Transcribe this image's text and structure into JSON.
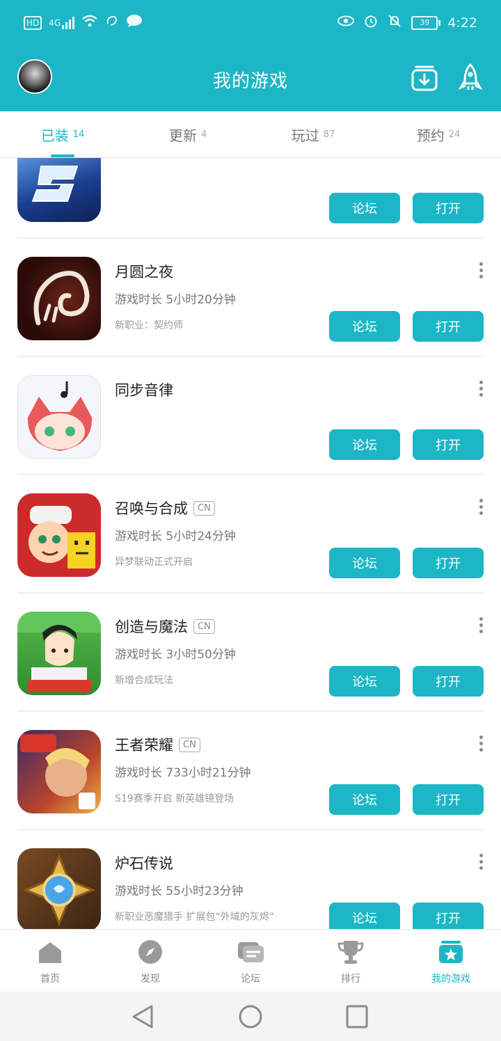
{
  "status_bar": {
    "hd": "HD",
    "network": "4G",
    "battery": "39",
    "time": "4:22"
  },
  "header": {
    "title": "我的游戏"
  },
  "tabs": [
    {
      "label": "已装",
      "count": "14",
      "active": true
    },
    {
      "label": "更新",
      "count": "4",
      "active": false
    },
    {
      "label": "玩过",
      "count": "87",
      "active": false
    },
    {
      "label": "预约",
      "count": "24",
      "active": false
    }
  ],
  "buttons": {
    "forum": "论坛",
    "open": "打开"
  },
  "games": [
    {
      "name": "",
      "cn": "",
      "play_time": "",
      "note": ""
    },
    {
      "name": "月圆之夜",
      "cn": "",
      "play_time": "游戏时长 5小时20分钟",
      "note": "新职业：契约师"
    },
    {
      "name": "同步音律",
      "cn": "",
      "play_time": "",
      "note": ""
    },
    {
      "name": "召唤与合成",
      "cn": "CN",
      "play_time": "游戏时长 5小时24分钟",
      "note": "异梦联动正式开启"
    },
    {
      "name": "创造与魔法",
      "cn": "CN",
      "play_time": "游戏时长 3小时50分钟",
      "note": "新增合成玩法"
    },
    {
      "name": "王者荣耀",
      "cn": "CN",
      "play_time": "游戏时长 733小时21分钟",
      "note": "S19赛季开启 新英雄镜登场"
    },
    {
      "name": "炉石传说",
      "cn": "",
      "play_time": "游戏时长 55小时23分钟",
      "note": "新职业恶魔猎手 扩展包“外域的灰烬”"
    }
  ],
  "bottom_nav": [
    {
      "label": "首页",
      "icon": "home-icon"
    },
    {
      "label": "发现",
      "icon": "compass-icon"
    },
    {
      "label": "论坛",
      "icon": "chat-icon"
    },
    {
      "label": "排行",
      "icon": "trophy-icon"
    },
    {
      "label": "我的游戏",
      "icon": "my-games-icon",
      "active": true
    }
  ],
  "colors": {
    "accent": "#1cb6c6",
    "text": "#222222",
    "muted": "#777777"
  }
}
